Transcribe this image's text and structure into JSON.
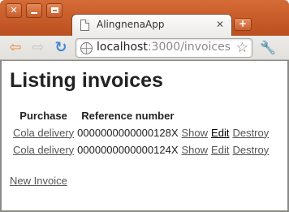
{
  "browser": {
    "window_buttons": {
      "close": "✕",
      "minimize": "",
      "maximize": ""
    },
    "tab": {
      "title": "AlingnenaApp",
      "close": "✕"
    },
    "new_tab": "+",
    "nav": {
      "back": "⇦",
      "forward": "⇨",
      "reload": "↻"
    },
    "address": {
      "host": "localhost",
      "rest": ":3000/invoices"
    },
    "icons": {
      "bookmark": "☆",
      "wrench": "🔧"
    }
  },
  "page": {
    "title": "Listing invoices",
    "columns": [
      "Purchase",
      "Reference number"
    ],
    "rows": [
      {
        "purchase": "Cola delivery",
        "reference": "0000000000000128X",
        "show": "Show",
        "edit": "Edit",
        "destroy": "Destroy"
      },
      {
        "purchase": "Cola delivery",
        "reference": "0000000000000124X",
        "show": "Show",
        "edit": "Edit",
        "destroy": "Destroy"
      }
    ],
    "new_link": "New Invoice"
  },
  "colors": {
    "titlebar": "#c65a28",
    "link": "#555555",
    "visited_link": "#000000"
  }
}
